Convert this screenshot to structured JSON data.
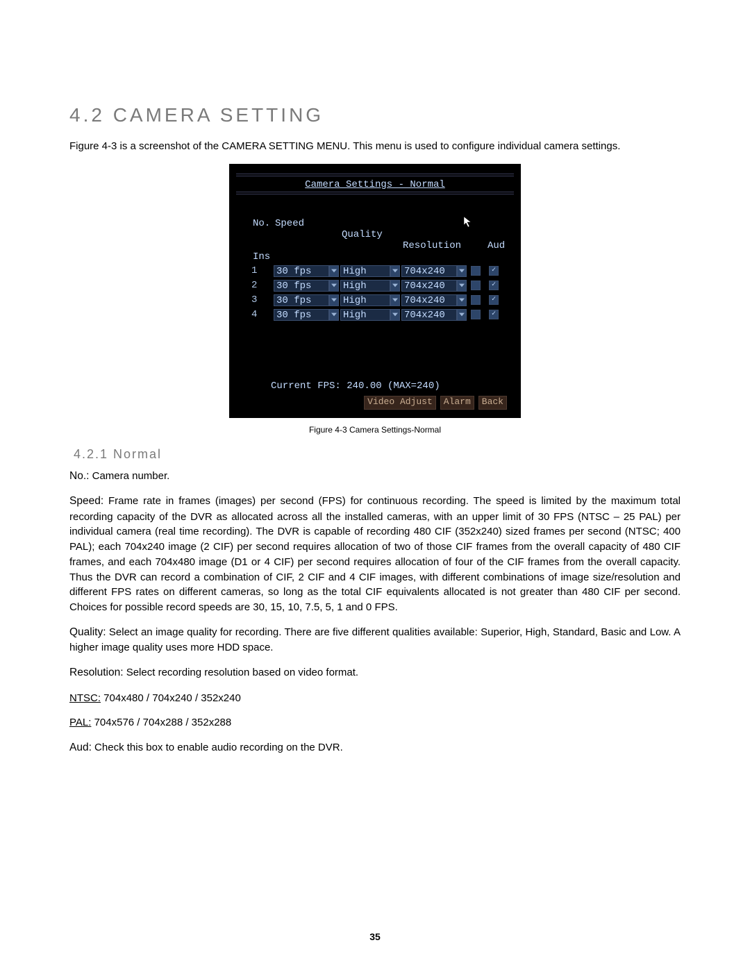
{
  "heading": "4.2 CAMERA SETTING",
  "intro_before": "Figure 4-3 is a screenshot of the ",
  "intro_menu": "CAMERA SETTING MENU",
  "intro_after": ". This menu is used to configure individual camera settings.",
  "screenshot": {
    "title": "Camera Settings - Normal",
    "columns": {
      "no": "No.",
      "speed": "Speed",
      "quality": "Quality",
      "resolution": "Resolution",
      "aud": "Aud",
      "ins": "Ins"
    },
    "rows": [
      {
        "no": "1",
        "speed": "30 fps",
        "quality": "High",
        "resolution": "704x240",
        "aud": false,
        "ins": true
      },
      {
        "no": "2",
        "speed": "30 fps",
        "quality": "High",
        "resolution": "704x240",
        "aud": false,
        "ins": true
      },
      {
        "no": "3",
        "speed": "30 fps",
        "quality": "High",
        "resolution": "704x240",
        "aud": false,
        "ins": true
      },
      {
        "no": "4",
        "speed": "30 fps",
        "quality": "High",
        "resolution": "704x240",
        "aud": false,
        "ins": true
      }
    ],
    "status": "Current FPS: 240.00 (MAX=240)",
    "footer": {
      "video_adjust": "Video Adjust",
      "alarm": "Alarm",
      "back": "Back"
    }
  },
  "figure_caption": "Figure 4-3 Camera Settings-Normal",
  "subheading": "4.2.1 Normal",
  "defs": {
    "no_label": "No.:",
    "no_text": " Camera number.",
    "speed_label": "Speed:",
    "speed_text": " Frame rate in frames (images) per second (FPS) for continuous recording. The speed is limited by the maximum total recording capacity of the DVR as allocated across all the installed cameras, with an upper limit of 30 FPS (NTSC – 25 PAL) per individual camera (real time recording). The DVR is capable of recording 480 CIF (352x240) sized frames per second (NTSC; 400 PAL); each 704x240 image (2 CIF) per second requires allocation of two of those CIF frames from the overall capacity of 480 CIF frames, and each 704x480 image (D1 or 4 CIF) per second requires allocation of four of the CIF frames from the overall capacity.  Thus the DVR can record a combination of CIF, 2 CIF and 4 CIF images, with different combinations of image size/resolution and different FPS rates on different cameras, so long as the total CIF equivalents allocated is not greater than 480 CIF per second.  Choices for possible record speeds are 30, 15, 10, 7.5, 5, 1 and 0 FPS.",
    "quality_label": "Quality:",
    "quality_text": " Select an image quality for recording. There are five different qualities available: Superior, High, Standard, Basic and Low.  A higher image quality uses more HDD space.",
    "resolution_label": "Resolution:",
    "resolution_text": " Select recording resolution based on video format.",
    "ntsc_label": "NTSC:",
    "ntsc_text": " 704x480 / 704x240 / 352x240",
    "pal_label": "PAL:",
    "pal_text": " 704x576 / 704x288 / 352x288",
    "aud_label": "Aud:",
    "aud_text": " Check this box to enable audio recording on the DVR."
  },
  "page_number": "35"
}
